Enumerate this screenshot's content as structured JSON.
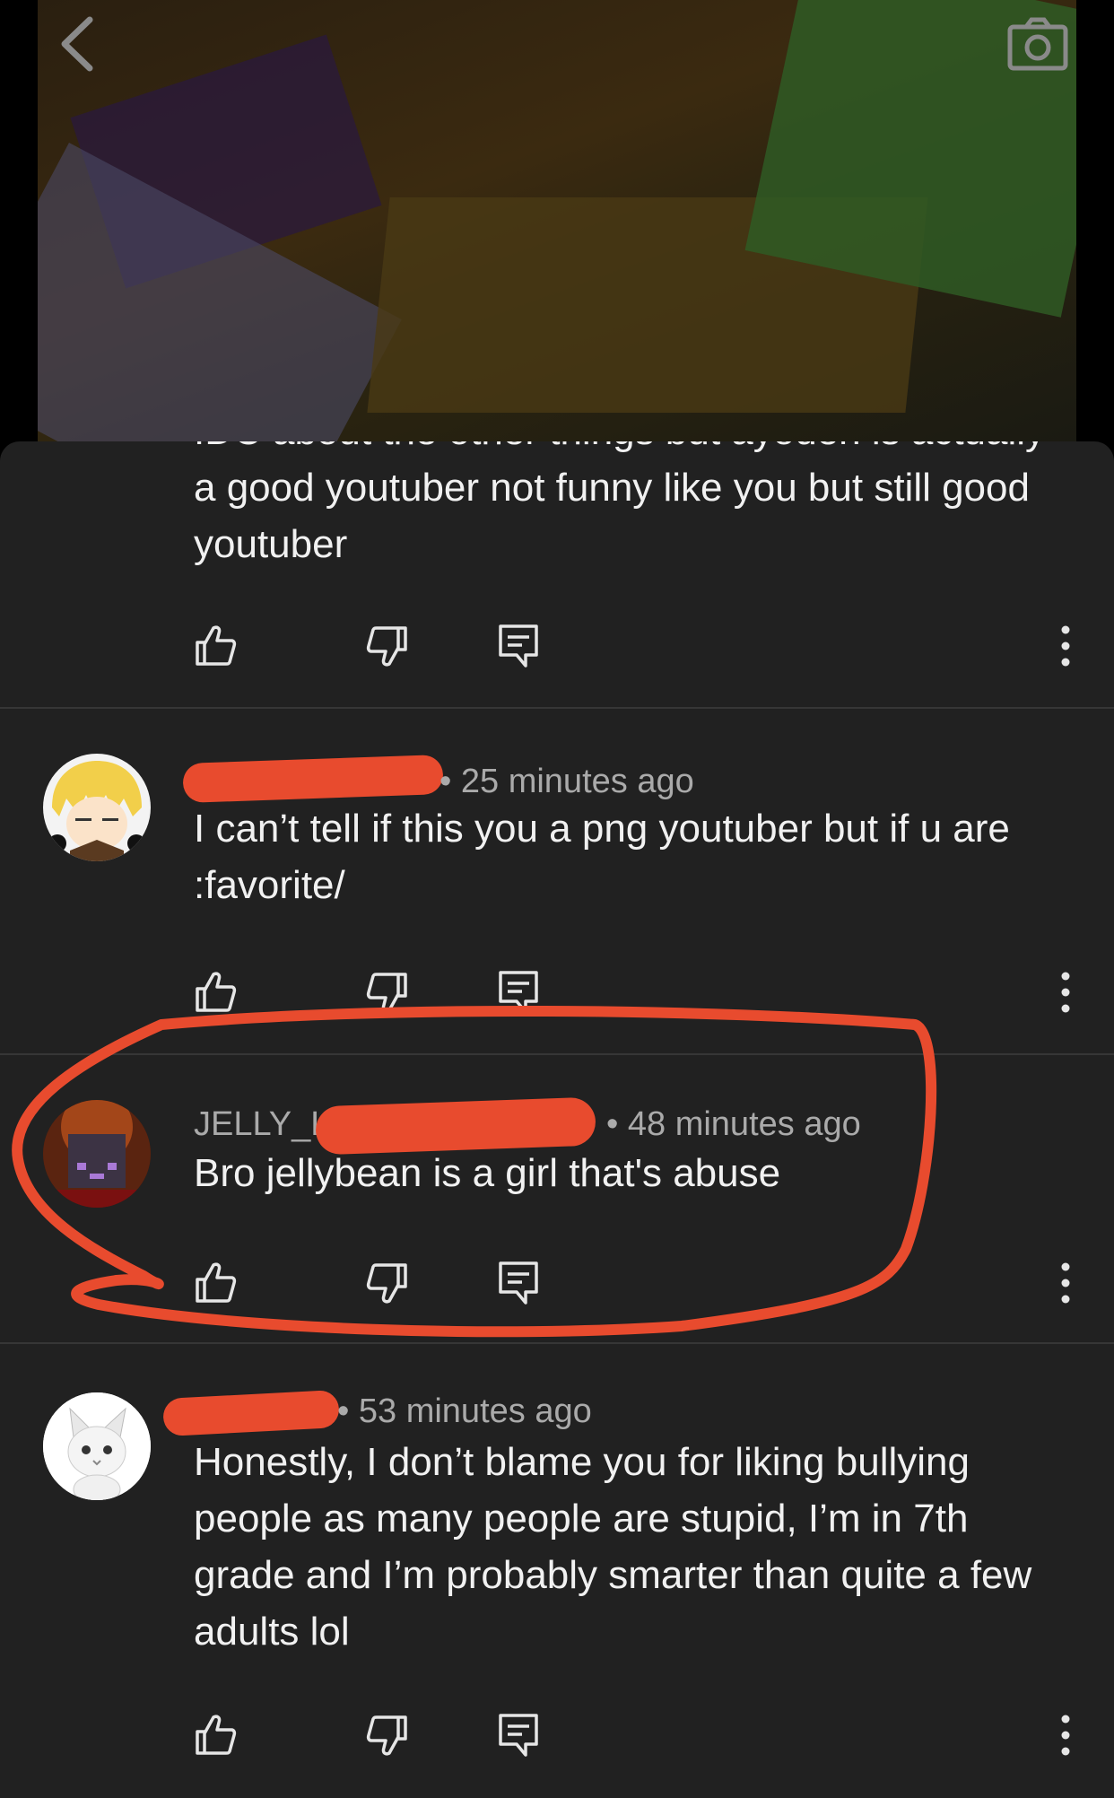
{
  "video": {
    "back_icon": "chevron-left-icon",
    "camera_icon": "camera-icon"
  },
  "comments": [
    {
      "author": "",
      "time": "",
      "text_clipped_line": "IDC about the other things but ayoden is actually",
      "text": "a good youtuber not funny like you but still good youtuber",
      "avatar": "avatar-top"
    },
    {
      "author": "",
      "time": "25 minutes ago",
      "text": "I can’t tell if this you a png youtuber but if u are :favorite/",
      "avatar": "anime-avatar"
    },
    {
      "author": "JELLY_L",
      "time": "48 minutes ago",
      "text": "Bro jellybean is a girl that's abuse",
      "avatar": "minecraft-avatar"
    },
    {
      "author": "",
      "time": "53 minutes ago",
      "text": "Honestly, I don’t blame you for liking bullying people as many people are stupid, I’m in 7th grade and I’m probably smarter than quite a few adults lol",
      "avatar": "cat-avatar"
    }
  ],
  "actions": {
    "like_icon": "thumbs-up-icon",
    "dislike_icon": "thumbs-down-icon",
    "reply_icon": "reply-icon",
    "more_icon": "more-vertical-icon"
  },
  "colors": {
    "sheet": "#212121",
    "annotation": "#e84b2e",
    "meta": "#aaaaaa",
    "text": "#f1f1f1"
  }
}
